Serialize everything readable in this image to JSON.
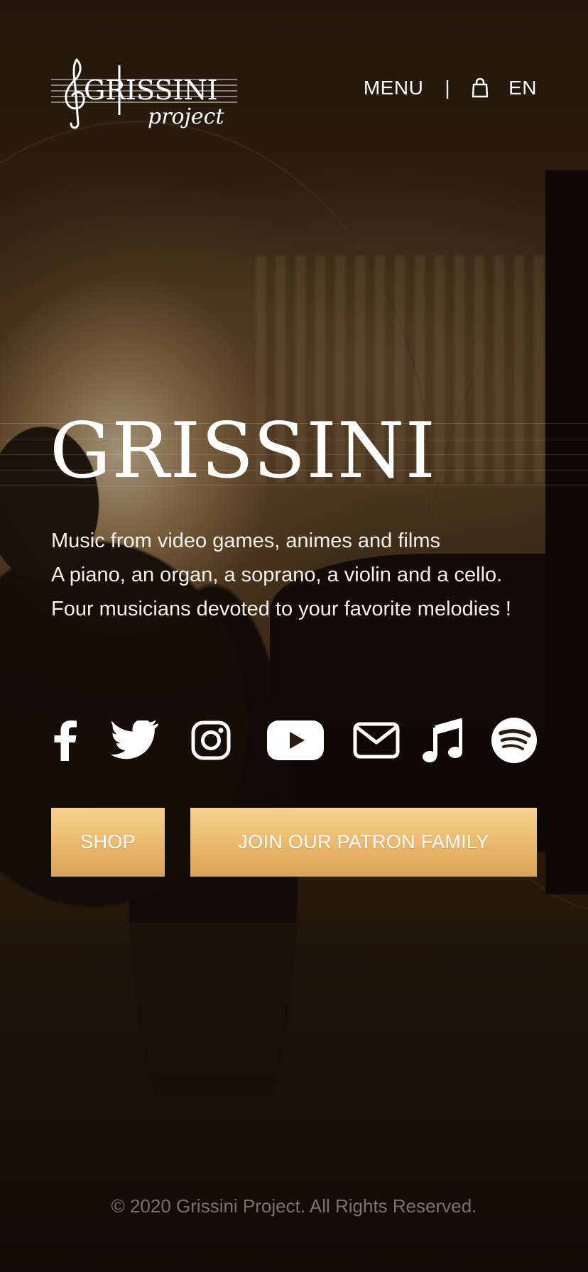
{
  "header": {
    "logo_text": "GRISSINI",
    "logo_subtext": "project",
    "menu_label": "MENU",
    "separator": "|",
    "cart_icon": "shopping-bag-icon",
    "language": "EN"
  },
  "hero": {
    "title": "GRISSINI",
    "tagline": [
      "Music from video games, animes and films",
      "A piano, an organ, a soprano, a violin and a cello.",
      "Four musicians devoted to your favorite melodies !"
    ]
  },
  "socials": [
    {
      "name": "facebook",
      "icon": "facebook-icon"
    },
    {
      "name": "twitter",
      "icon": "twitter-icon"
    },
    {
      "name": "instagram",
      "icon": "instagram-icon"
    },
    {
      "name": "youtube",
      "icon": "youtube-icon"
    },
    {
      "name": "email",
      "icon": "mail-icon"
    },
    {
      "name": "apple-music",
      "icon": "music-note-icon"
    },
    {
      "name": "spotify",
      "icon": "spotify-icon"
    }
  ],
  "buttons": {
    "shop_label": "SHOP",
    "patron_label": "JOIN OUR PATRON FAMILY"
  },
  "footer": {
    "copyright": "© 2020 Grissini Project. All Rights Reserved."
  },
  "colors": {
    "button_gold": "#e9b86c",
    "text": "#ffffff",
    "background": "#1a120a"
  }
}
